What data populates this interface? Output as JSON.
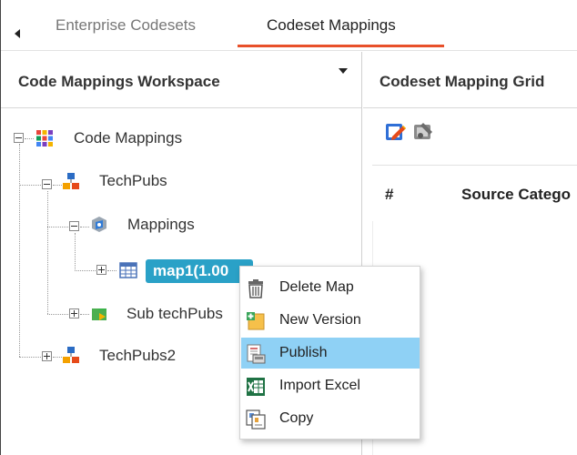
{
  "tabs": [
    {
      "label": "Enterprise Codesets",
      "active": false
    },
    {
      "label": "Codeset Mappings",
      "active": true
    }
  ],
  "accent_color": "#e8502a",
  "selection_color": "#2aa1c7",
  "left_panel": {
    "title": "Code Mappings Workspace"
  },
  "right_panel": {
    "title": "Codeset Mapping Grid",
    "toolbar": [
      {
        "icon": "edit-icon"
      },
      {
        "icon": "tools-icon"
      }
    ],
    "columns": [
      "#",
      "Source Catego"
    ]
  },
  "tree": {
    "root": {
      "label": "Code Mappings",
      "icon": "grid-colorful-icon"
    },
    "techpubs": {
      "label": "TechPubs",
      "icon": "org-chart-icon"
    },
    "mappings": {
      "label": "Mappings",
      "icon": "mapping-folder-icon"
    },
    "map1": {
      "label": "map1(1.00",
      "icon": "calendar-grid-icon"
    },
    "sub_techpubs": {
      "label": "Sub techPubs",
      "icon": "sub-folder-icon"
    },
    "techpubs2": {
      "label": "TechPubs2",
      "icon": "org-chart-icon"
    }
  },
  "context_menu": {
    "items": [
      {
        "label": "Delete Map",
        "icon": "trash-icon"
      },
      {
        "label": "New Version",
        "icon": "new-version-icon"
      },
      {
        "label": "Publish",
        "icon": "publish-icon",
        "highlighted": true
      },
      {
        "label": "Import Excel",
        "icon": "excel-icon"
      },
      {
        "label": "Copy",
        "icon": "copy-icon"
      }
    ]
  }
}
